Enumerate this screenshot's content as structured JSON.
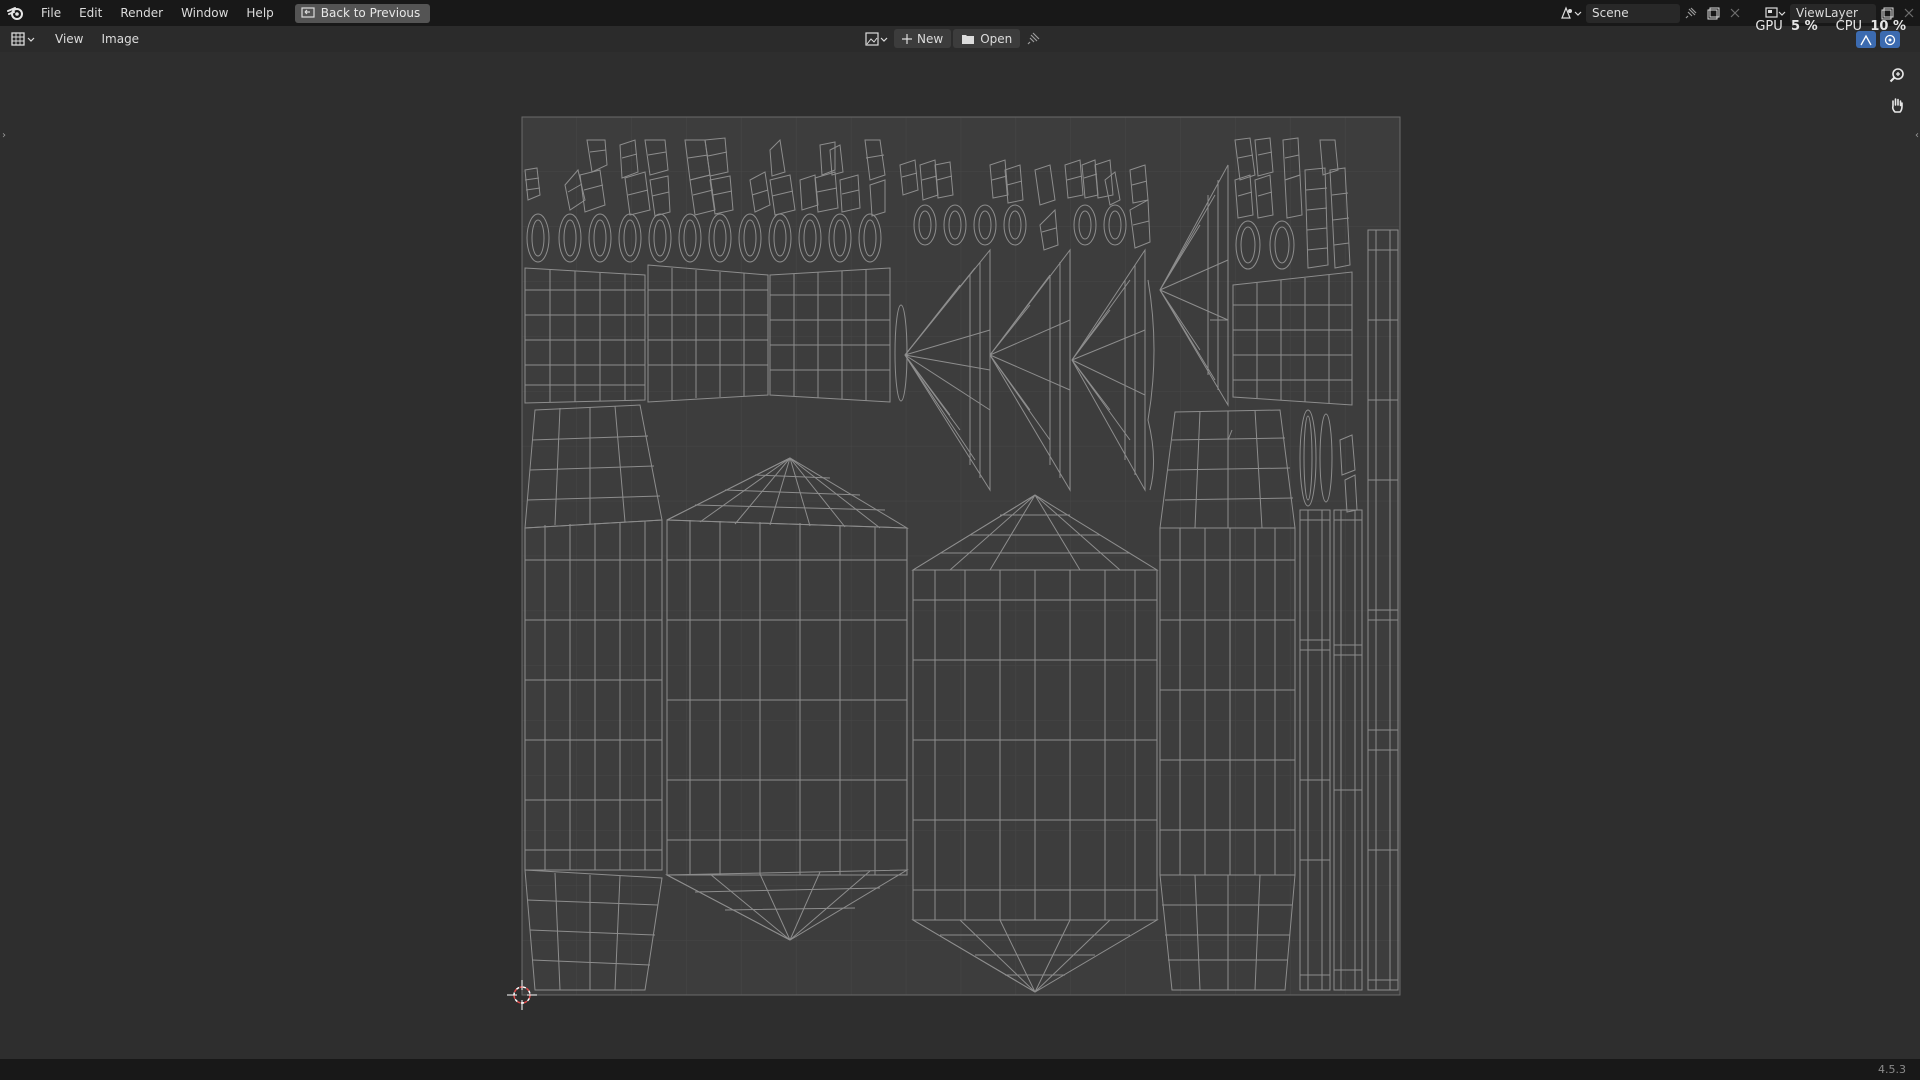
{
  "menu": {
    "file": "File",
    "edit": "Edit",
    "render": "Render",
    "window": "Window",
    "help": "Help",
    "back_to_previous": "Back to Previous"
  },
  "scene": {
    "name": "Scene"
  },
  "view_layer": {
    "name": "ViewLayer"
  },
  "header": {
    "view": "View",
    "image": "Image",
    "new_label": "New",
    "open_label": "Open"
  },
  "stats": {
    "gpu_label": "GPU",
    "gpu_value": "5 %",
    "cpu_label": "CPU",
    "cpu_value": "10 %"
  },
  "status": {
    "version": "4.5.3"
  },
  "colors": {
    "background": "#2e2e2e",
    "topbar": "#181818",
    "uv_lines": "#8d8d8d",
    "grid": "#4a4a4a",
    "cursor": "#e14a4a"
  },
  "icons": {
    "app": "blender-logo-icon",
    "editor_type": "image-editor-icon",
    "zoom": "zoom-icon",
    "pan": "hand-icon",
    "cursor": "2d-cursor-icon"
  }
}
